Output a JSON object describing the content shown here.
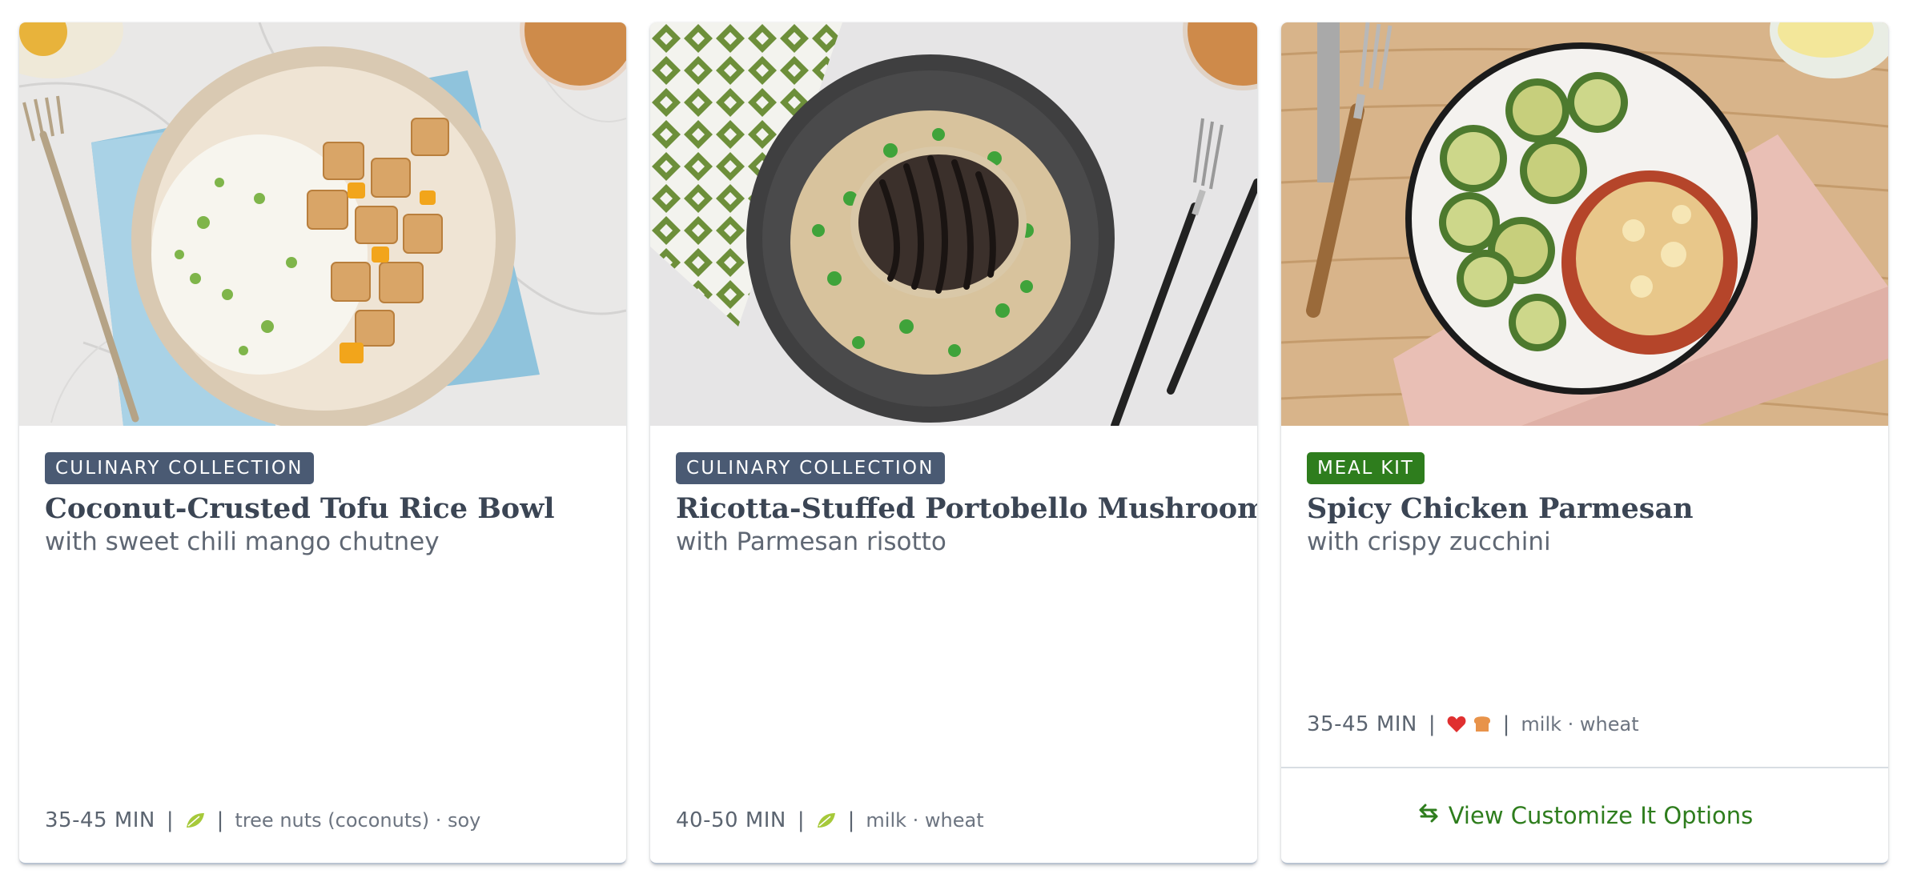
{
  "cards": [
    {
      "badge": "CULINARY COLLECTION",
      "title": "Coconut-Crusted Tofu Rice Bowl",
      "subtitle": "with sweet chili mango chutney",
      "time": "35-45 MIN",
      "allergens": "tree nuts (coconuts) · soy",
      "icons": [
        "leaf-icon"
      ]
    },
    {
      "badge": "CULINARY COLLECTION",
      "title": "Ricotta-Stuffed Portobello Mushroom",
      "subtitle": "with Parmesan risotto",
      "time": "40-50 MIN",
      "allergens": "milk · wheat",
      "icons": [
        "leaf-icon"
      ]
    },
    {
      "badge": "MEAL KIT",
      "title": "Spicy Chicken Parmesan",
      "subtitle": "with crispy zucchini",
      "time": "35-45 MIN",
      "allergens": "milk · wheat",
      "icons": [
        "heart-icon",
        "bread-icon"
      ],
      "customize_label": "View Customize It Options"
    }
  ],
  "colors": {
    "badge_collection": "#4a5a73",
    "badge_mealkit": "#2e7d1d",
    "customize_text": "#2e7d1d",
    "title": "#3b4554",
    "leaf": "#a6c93a",
    "heart": "#e03030",
    "bread": "#e8934a"
  }
}
